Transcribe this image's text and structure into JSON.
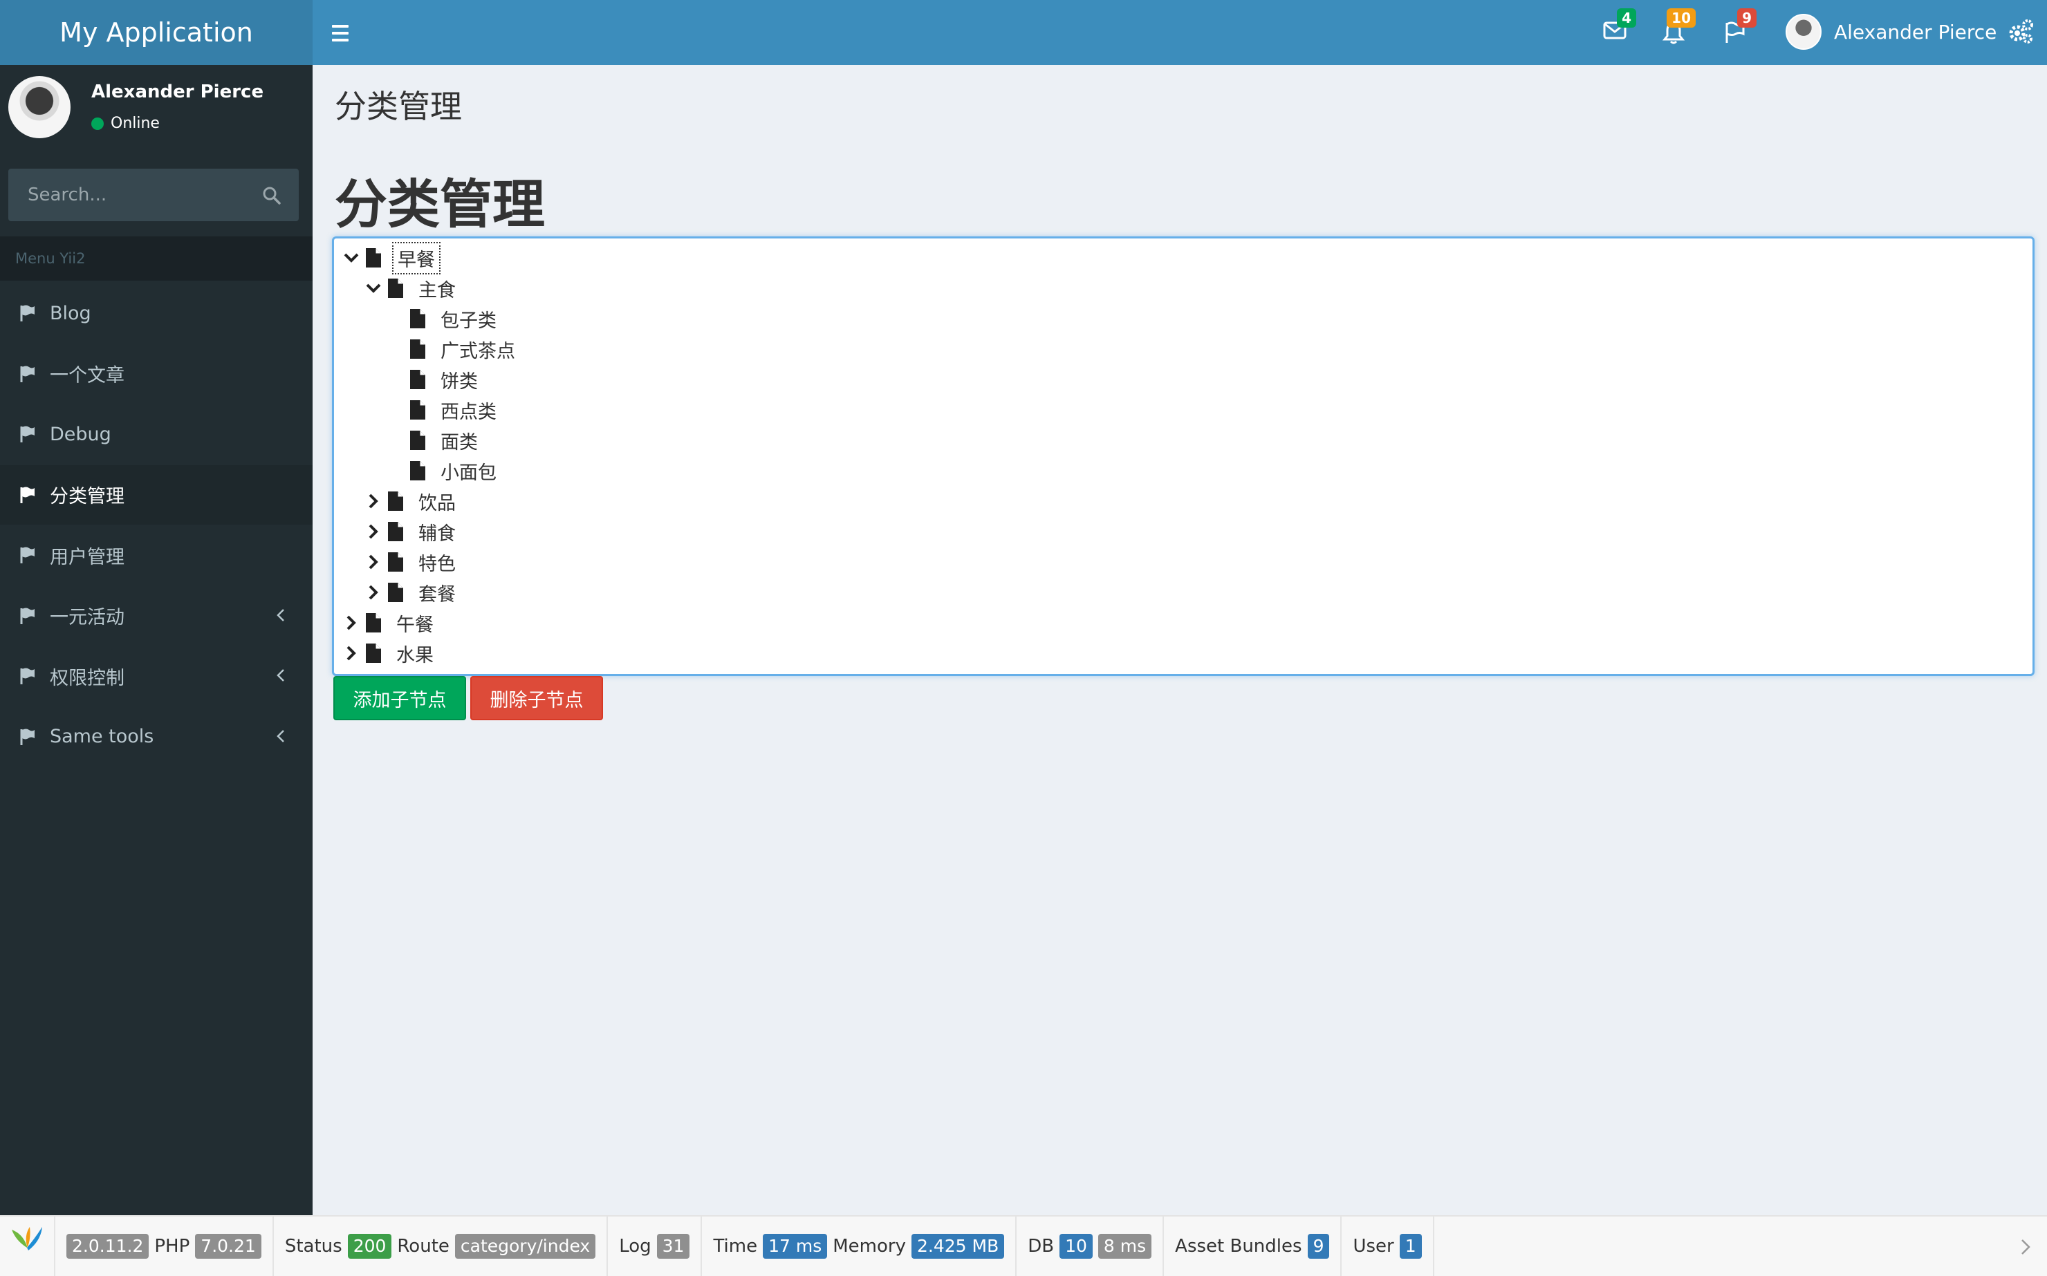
{
  "header": {
    "app_title": "My Application",
    "user_name": "Alexander Pierce",
    "badges": {
      "messages": "4",
      "notifications": "10",
      "tasks": "9"
    },
    "badge_colors": {
      "messages": "#00a65a",
      "notifications": "#f39c12",
      "tasks": "#dd4b39"
    }
  },
  "sidebar": {
    "user_name": "Alexander Pierce",
    "status": "Online",
    "search_placeholder": "Search...",
    "menu_header": "Menu Yii2",
    "items": [
      {
        "label": "Blog",
        "has_submenu": false,
        "active": false
      },
      {
        "label": "一个文章",
        "has_submenu": false,
        "active": false
      },
      {
        "label": "Debug",
        "has_submenu": false,
        "active": false
      },
      {
        "label": "分类管理",
        "has_submenu": false,
        "active": true
      },
      {
        "label": "用户管理",
        "has_submenu": false,
        "active": false
      },
      {
        "label": "一元活动",
        "has_submenu": true,
        "active": false
      },
      {
        "label": "权限控制",
        "has_submenu": true,
        "active": false
      },
      {
        "label": "Same tools",
        "has_submenu": true,
        "active": false
      }
    ]
  },
  "content": {
    "breadcrumb_title": "分类管理",
    "heading": "分类管理",
    "tree": [
      {
        "label": "早餐",
        "level": 0,
        "state": "expanded",
        "selected": true
      },
      {
        "label": "主食",
        "level": 1,
        "state": "expanded"
      },
      {
        "label": "包子类",
        "level": 2,
        "state": "leaf"
      },
      {
        "label": "广式茶点",
        "level": 2,
        "state": "leaf"
      },
      {
        "label": "饼类",
        "level": 2,
        "state": "leaf"
      },
      {
        "label": "西点类",
        "level": 2,
        "state": "leaf"
      },
      {
        "label": "面类",
        "level": 2,
        "state": "leaf"
      },
      {
        "label": "小面包",
        "level": 2,
        "state": "leaf"
      },
      {
        "label": "饮品",
        "level": 1,
        "state": "collapsed"
      },
      {
        "label": "辅食",
        "level": 1,
        "state": "collapsed"
      },
      {
        "label": "特色",
        "level": 1,
        "state": "collapsed"
      },
      {
        "label": "套餐",
        "level": 1,
        "state": "collapsed"
      },
      {
        "label": "午餐",
        "level": 0,
        "state": "collapsed"
      },
      {
        "label": "水果",
        "level": 0,
        "state": "collapsed"
      }
    ],
    "buttons": {
      "add_child": "添加子节点",
      "delete_child": "删除子节点"
    }
  },
  "debug_toolbar": {
    "yii_version": "2.0.11.2",
    "php_label": "PHP",
    "php_version": "7.0.21",
    "status_label": "Status",
    "status": "200",
    "route_label": "Route",
    "route": "category/index",
    "log_label": "Log",
    "log": "31",
    "time_label": "Time",
    "time": "17 ms",
    "memory_label": "Memory",
    "memory": "2.425 MB",
    "db_label": "DB",
    "db_queries": "10",
    "db_time": "8 ms",
    "assets_label": "Asset Bundles",
    "assets": "9",
    "user_label": "User",
    "user": "1"
  }
}
